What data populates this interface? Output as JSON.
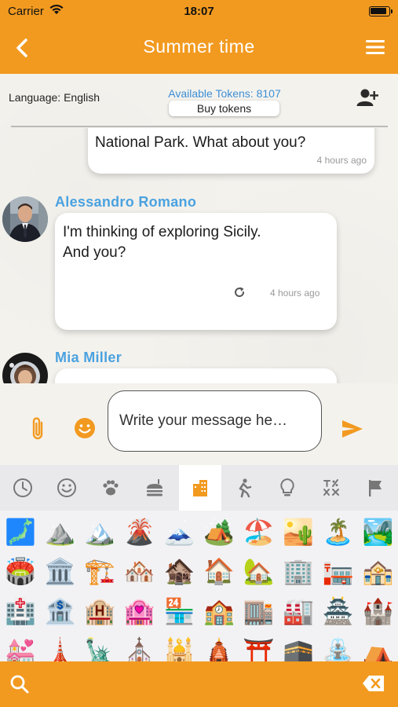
{
  "status": {
    "carrier": "Carrier",
    "time": "18:07"
  },
  "nav": {
    "title": "Summer time"
  },
  "info": {
    "language": "Language: English",
    "tokens": "Available Tokens: 8107",
    "buy_label": "Buy tokens"
  },
  "messages": [
    {
      "sender": "",
      "text": "National Park. What about you?",
      "time": "4 hours ago"
    },
    {
      "sender": "Alessandro Romano",
      "text_line1": "I'm thinking of exploring Sicily.",
      "text_line2": "And you?",
      "time": "4 hours ago"
    },
    {
      "sender": "Mia Miller",
      "text": ""
    }
  ],
  "composer": {
    "placeholder": "Write your message he…"
  },
  "emoji_categories": [
    "recent",
    "smileys",
    "animals",
    "food",
    "places",
    "activity",
    "objects",
    "symbols",
    "flags"
  ],
  "emoji_rows": [
    [
      "🗾",
      "⛰️",
      "🏔️",
      "🌋",
      "🗻",
      "🏕️",
      "🏖️",
      "🏜️",
      "🏝️",
      "🏞️"
    ],
    [
      "🏟️",
      "🏛️",
      "🏗️",
      "🏘️",
      "🏚️",
      "🏠",
      "🏡",
      "🏢",
      "🏣",
      "🏤"
    ],
    [
      "🏥",
      "🏦",
      "🏨",
      "🏩",
      "🏪",
      "🏫",
      "🏬",
      "🏭",
      "🏯",
      "🏰"
    ],
    [
      "💒",
      "🗼",
      "🗽",
      "⛪",
      "🕌",
      "🛕",
      "⛩️",
      "🕋",
      "⛲",
      "⛺"
    ]
  ],
  "colors": {
    "accent": "#f29a20",
    "link": "#4aa2e0"
  }
}
